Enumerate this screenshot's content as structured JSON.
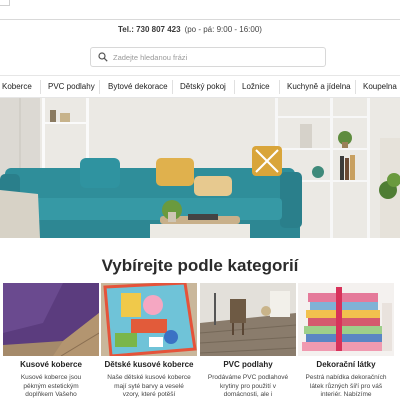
{
  "header": {
    "phone": "Tel.: 730 807 423",
    "hours": "(po - pá: 9:00 - 16:00)"
  },
  "search": {
    "placeholder": "Zadejte hledanou frázi",
    "icon": "search-icon"
  },
  "nav": {
    "items": [
      {
        "label": "Koberce"
      },
      {
        "label": "PVC podlahy"
      },
      {
        "label": "Bytové dekorace"
      },
      {
        "label": "Dětský pokoj"
      },
      {
        "label": "Ložnice"
      },
      {
        "label": "Kuchyně a jídelna"
      },
      {
        "label": "Koupelna"
      }
    ]
  },
  "main": {
    "heading": "Vybírejte podle kategorií",
    "categories": [
      {
        "title": "Kusové koberce",
        "desc": "Kusové koberce jsou pěkným estetickým doplňkem Vašeho"
      },
      {
        "title": "Dětské kusové koberce",
        "desc": "Naše dětské kusové koberce mají syté barvy a veselé vzory, které potěší"
      },
      {
        "title": "PVC podlahy",
        "desc": "Prodáváme PVC podlahové krytiny pro použití v domácnosti, ale i"
      },
      {
        "title": "Dekorační látky",
        "desc": "Pestrá nabídka dekoračních látek různých šíří pro váš interiér. Nabízíme"
      }
    ]
  },
  "colors": {
    "sofa": "#2f8e9a",
    "accent_mustard": "#d9a53a",
    "wall": "#ecebe7",
    "shag_rug": "#5b3c7e"
  }
}
